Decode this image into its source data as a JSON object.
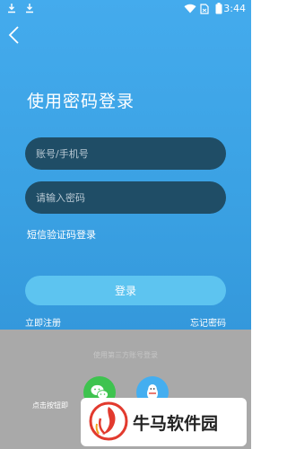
{
  "status_bar": {
    "time": "3:44"
  },
  "login": {
    "title": "使用密码登录",
    "account_placeholder": "账号/手机号",
    "password_placeholder": "请输入密码",
    "sms_login_link": "短信验证码登录",
    "login_button": "登录",
    "register_link": "立即注册",
    "forgot_link": "忘记密码"
  },
  "third_party": {
    "caption": "使用第三方账号登录",
    "agreement_text": "点击按钮即"
  },
  "watermark": {
    "text": "牛马软件园"
  }
}
